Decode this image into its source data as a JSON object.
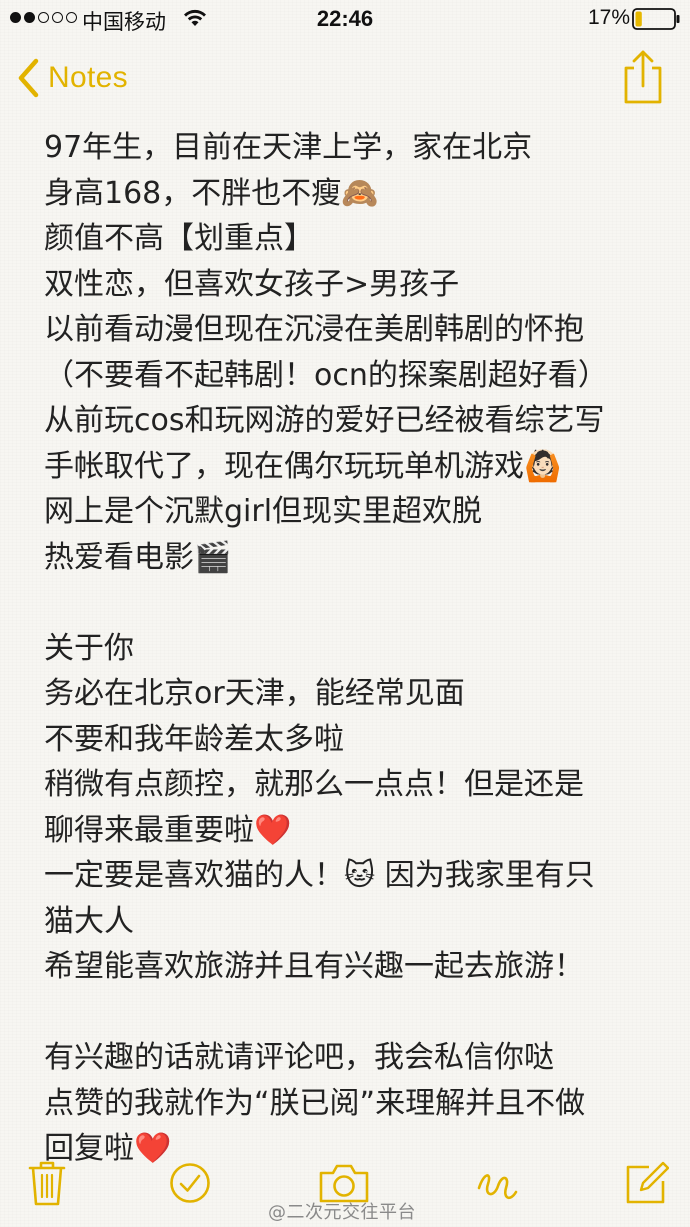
{
  "status_bar": {
    "carrier": "中国移动",
    "time": "22:46",
    "battery_percent": "17%",
    "battery_level": 0.17,
    "signal_bars_filled": 2,
    "signal_bars_total": 5
  },
  "nav": {
    "back_label": "Notes",
    "accent_color": "#e2b300",
    "share_icon": "share-icon"
  },
  "note": {
    "lines": [
      "97年生，目前在天津上学，家在北京",
      "身高168，不胖也不瘦🙈",
      "颜值不高【划重点】",
      "双性恋，但喜欢女孩子>男孩子",
      "以前看动漫但现在沉浸在美剧韩剧的怀抱",
      "（不要看不起韩剧！ocn的探案剧超好看）",
      "从前玩cos和玩网游的爱好已经被看综艺写",
      "手帐取代了，现在偶尔玩玩单机游戏🙆🏻",
      "网上是个沉默girl但现实里超欢脱",
      "热爱看电影🎬",
      "",
      "关于你",
      "务必在北京or天津，能经常见面",
      "不要和我年龄差太多啦",
      "稍微有点颜控，就那么一点点！但是还是",
      "聊得来最重要啦❤️",
      "一定要是喜欢猫的人！🐱 因为我家里有只",
      "猫大人",
      "希望能喜欢旅游并且有兴趣一起去旅游！",
      "",
      "有兴趣的话就请评论吧，我会私信你哒",
      "点赞的我就作为“朕已阅”来理解并且不做",
      "回复啦❤️"
    ]
  },
  "toolbar": {
    "icons": [
      "trash-icon",
      "checkmark-icon",
      "camera-icon",
      "sketch-icon",
      "compose-icon"
    ]
  },
  "watermark": "@二次元交往平台"
}
